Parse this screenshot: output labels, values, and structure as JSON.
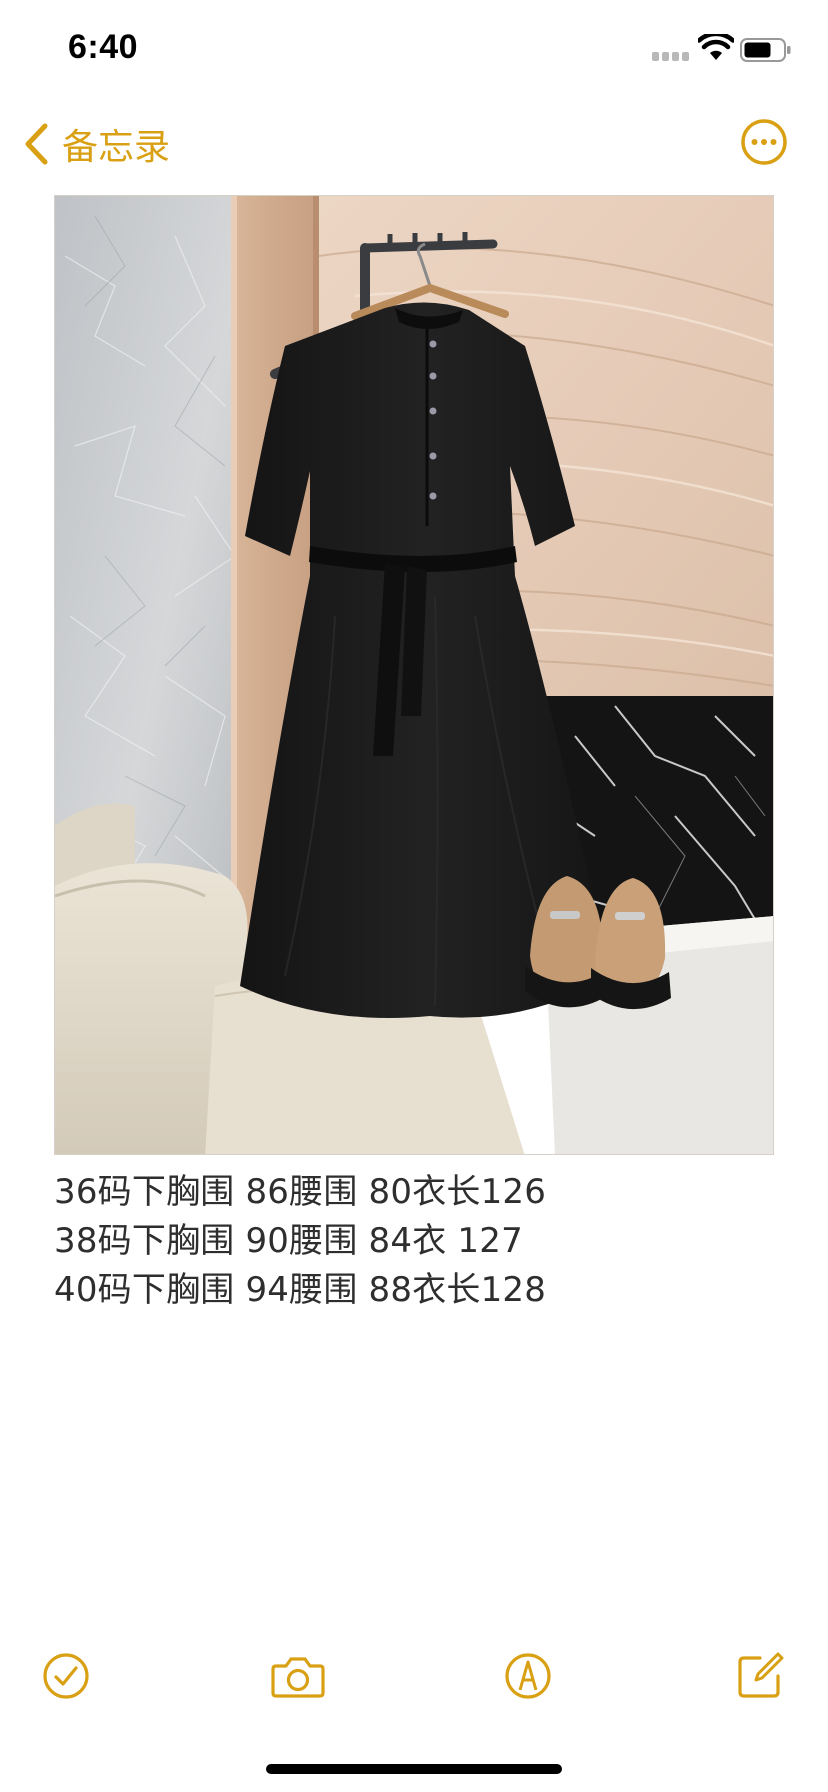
{
  "status_bar": {
    "time": "6:40"
  },
  "nav": {
    "back_label": "备忘录",
    "back_icon": "chevron-left-icon",
    "more_icon": "ellipsis-circle-icon"
  },
  "photo": {
    "subject": "black dress on hanger"
  },
  "note": {
    "lines": [
      "36码下胸围 86腰围 80衣长126",
      "38码下胸围 90腰围 84衣 127",
      "40码下胸围 94腰围 88衣长128"
    ]
  },
  "toolbar": {
    "checklist_icon": "checkmark-circle-icon",
    "camera_icon": "camera-icon",
    "markup_icon": "pen-circle-icon",
    "compose_icon": "compose-icon"
  },
  "colors": {
    "accent": "#d9a014",
    "text": "#2e2e2e"
  }
}
